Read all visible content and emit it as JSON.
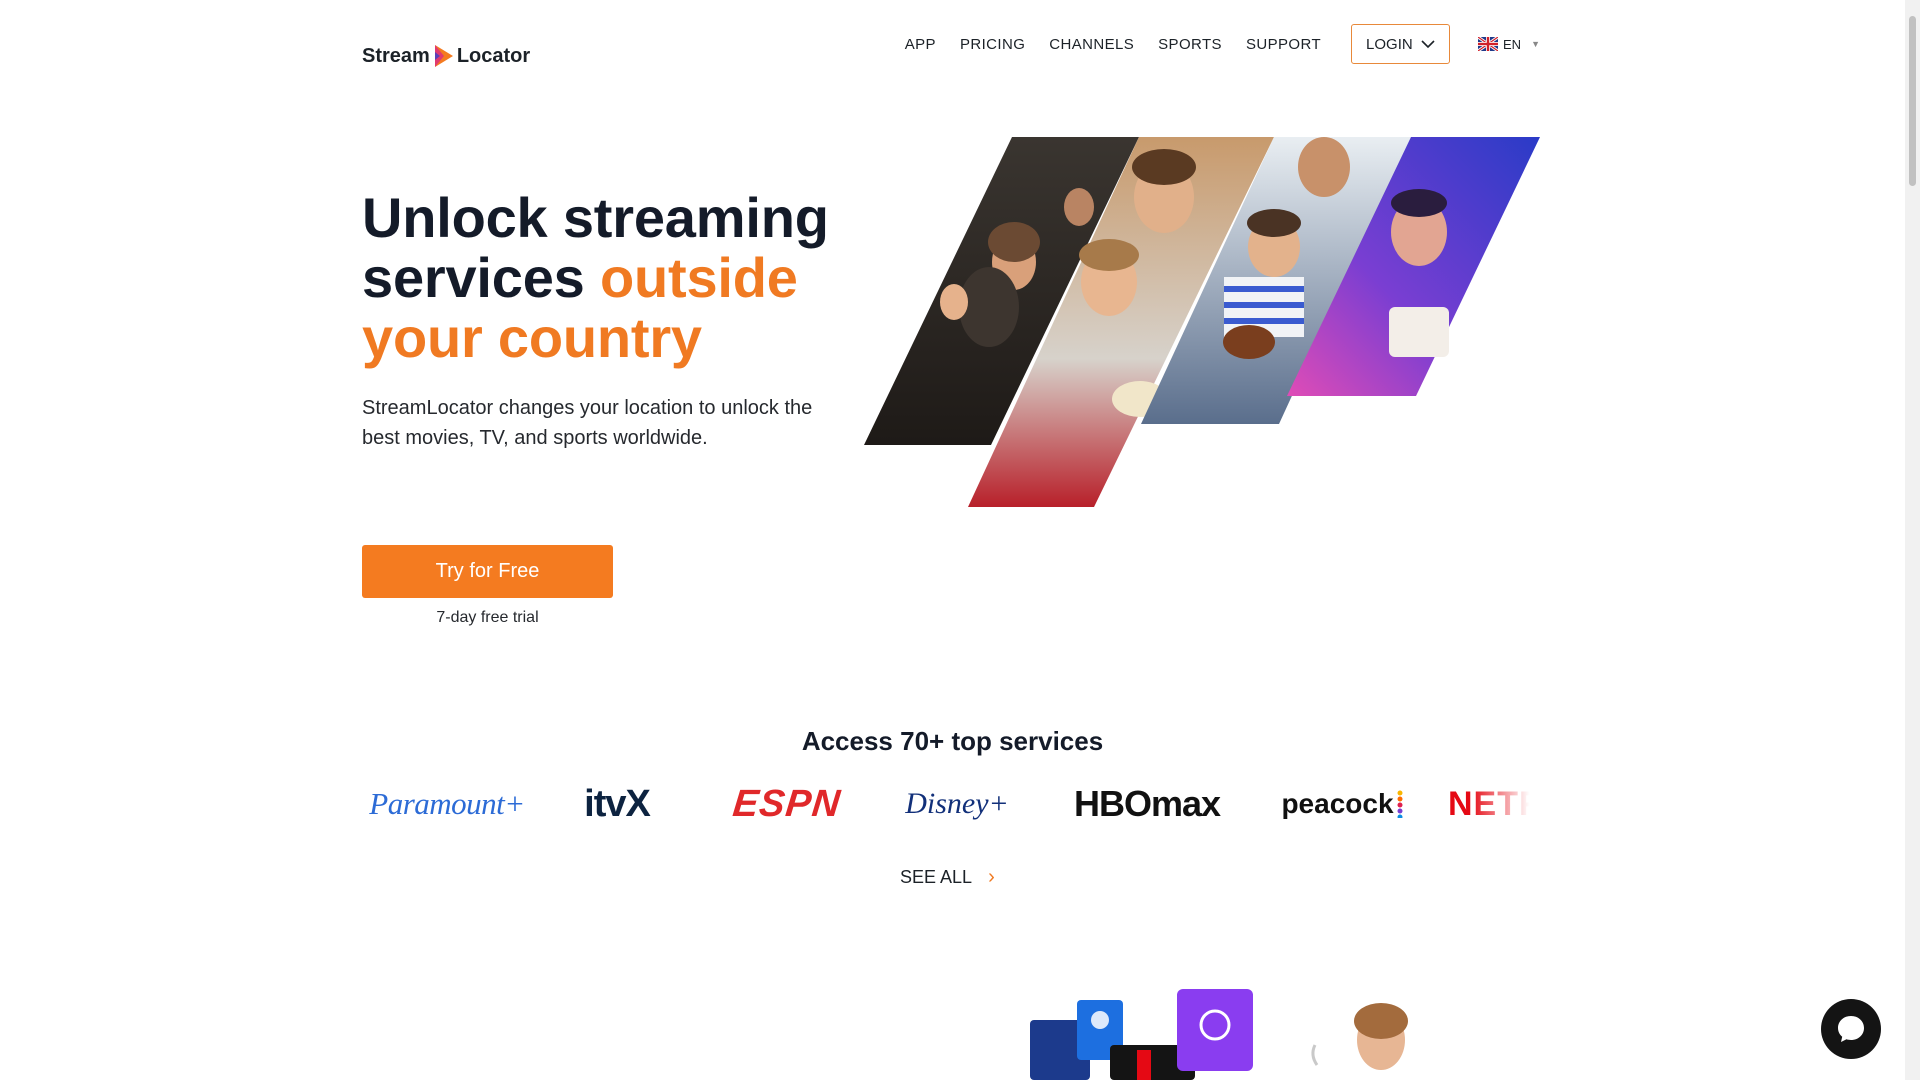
{
  "header": {
    "logo_left": "Stream",
    "logo_right": "Locator",
    "nav": [
      "APP",
      "PRICING",
      "CHANNELS",
      "SPORTS",
      "SUPPORT"
    ],
    "login_label": "LOGIN",
    "language": "EN"
  },
  "hero": {
    "title_line1": "Unlock streaming",
    "title_line2_dark": "services ",
    "title_line2_accent": "outside",
    "title_line3_accent": "your country",
    "subtitle": "StreamLocator changes your location to unlock the best movies, TV, and sports worldwide.",
    "cta_label": "Try for Free",
    "trial_note": "7-day free trial"
  },
  "services": {
    "title": "Access 70+ top services",
    "logos": [
      {
        "name": "Paramount+",
        "color": "#2c6bd6"
      },
      {
        "name": "itvX",
        "color": "#0d2340"
      },
      {
        "name": "ESPN",
        "color": "#e0282a"
      },
      {
        "name": "Disney+",
        "color": "#12307a"
      },
      {
        "name": "HBOmax",
        "color": "#111111"
      },
      {
        "name": "peacock",
        "color": "#111111"
      },
      {
        "name": "NETFLIX",
        "color": "#e50914"
      }
    ],
    "see_all": "SEE ALL"
  },
  "colors": {
    "accent": "#f47b20",
    "heading": "#141b29"
  }
}
